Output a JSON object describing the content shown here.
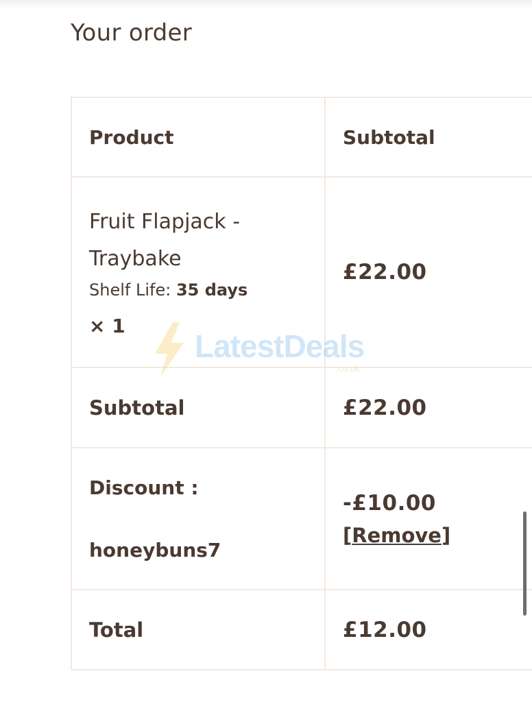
{
  "page_title": "Your order",
  "table": {
    "headers": {
      "product": "Product",
      "subtotal": "Subtotal"
    },
    "item": {
      "name_line1": "Fruit Flapjack -",
      "name_line2": "Traybake",
      "meta_label": "Shelf Life:",
      "meta_value": "35 days",
      "quantity": "× 1",
      "price": "£22.00"
    },
    "subtotal": {
      "label": "Subtotal",
      "value": "£22.00"
    },
    "discount": {
      "label": "Discount :",
      "code": "honeybuns7",
      "value": "-£10.00",
      "remove_open": "[",
      "remove_label": "Remove",
      "remove_close": "]"
    },
    "total": {
      "label": "Total",
      "value": "£12.00"
    }
  },
  "watermark": {
    "brand": "LatestDeals",
    "domain": ".co.uk"
  },
  "colors": {
    "text": "#4a3a32",
    "border": "#f4e9e1",
    "watermark_blue": "#5aa8e8",
    "watermark_yellow": "#f3c23d"
  }
}
